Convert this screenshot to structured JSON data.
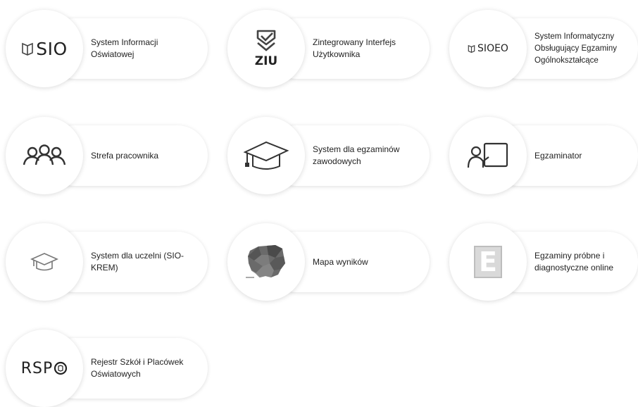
{
  "tiles": [
    {
      "label": "System Informacji Oświatowej",
      "logo_text": "SIO",
      "icon": "book-icon"
    },
    {
      "label": "Zintegrowany Interfejs Użytkownika",
      "logo_text": "ZIU",
      "icon": "shield-check-icon"
    },
    {
      "label": "System Informatyczny Obsługujący Egzaminy Ogólnokształcące",
      "logo_text": "SIOEO",
      "icon": "book-icon"
    },
    {
      "label": "Strefa pracownika",
      "icon": "people-icon"
    },
    {
      "label": "System dla egzaminów zawodowych",
      "icon": "graduation-cap-icon"
    },
    {
      "label": "Egzaminator",
      "icon": "user-board-icon"
    },
    {
      "label": "System dla uczelni (SIO-KREM)",
      "icon": "graduation-cap-icon"
    },
    {
      "label": "Mapa wyników",
      "icon": "poland-map-icon"
    },
    {
      "label": "Egzaminy próbne i diagnostyczne online",
      "logo_text": "E",
      "icon": "letter-e-icon"
    },
    {
      "label": "Rejestr Szkół i Placówek Oświatowych",
      "logo_text": "RSP",
      "icon": "rspo-logo-icon"
    }
  ]
}
